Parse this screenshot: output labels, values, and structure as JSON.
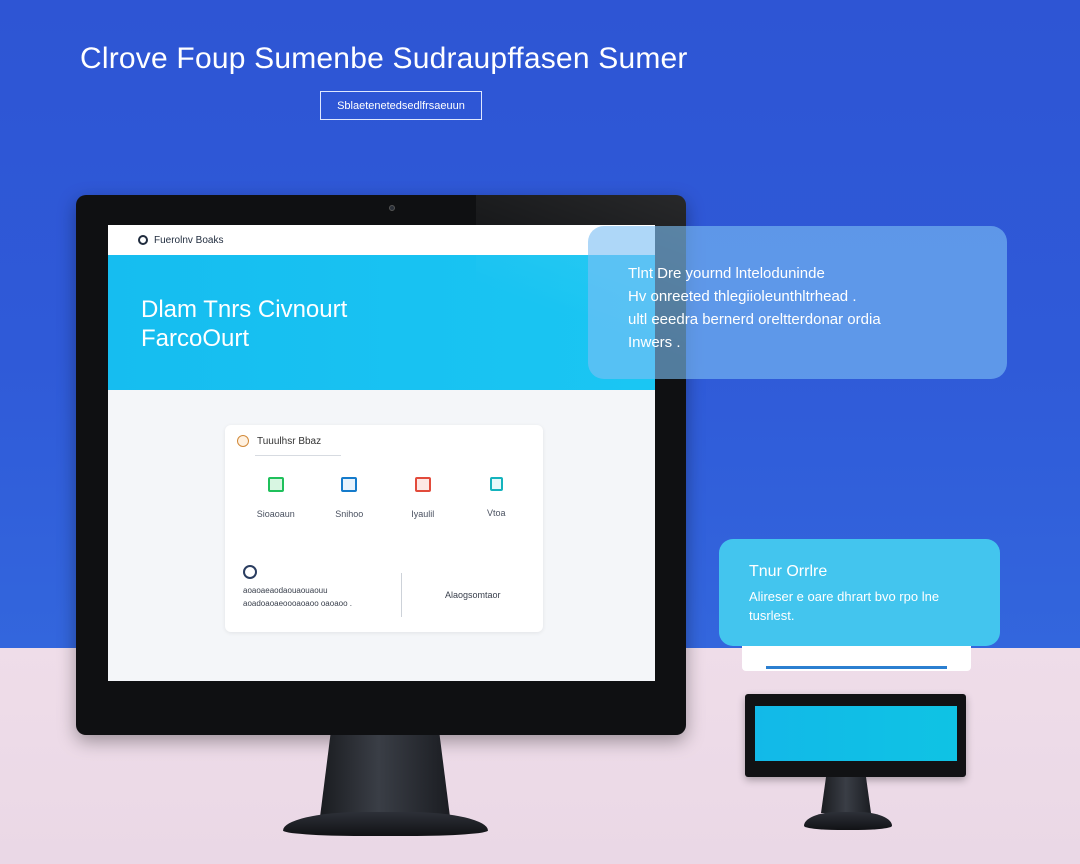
{
  "page": {
    "headline": "Clrove Foup Sumenbe Sudraupffasen Sumer",
    "subtag": "Sblaetenetedsedlfrsaeuun"
  },
  "monitor": {
    "app_name": "Fuerolnv Boaks",
    "hero_title_line1": "Dlam Tnrs Civnourt",
    "hero_title_line2": "FarcoOurt",
    "card": {
      "header_label": "Tuuulhsr Bbaz",
      "tiles": [
        {
          "label": "Sioaoaun",
          "icon": "chat-icon",
          "color": "#1fc05b"
        },
        {
          "label": "Snihoo",
          "icon": "folder-icon",
          "color": "#157bcb"
        },
        {
          "label": "Iyaulil",
          "icon": "calendar-icon",
          "color": "#e24b3b"
        },
        {
          "label": "Vtoa",
          "icon": "document-icon",
          "color": "#14b3bd"
        }
      ],
      "info_line1": "aoaoaeaodaouaouaouu",
      "info_line2": "aoadoaoaeoooaoaoo oaoaoo .",
      "info_action": "Alaogsomtaor"
    }
  },
  "callout_main": {
    "line1": "Tlnt  Dre  yournd lnteloduninde",
    "line2": "Hv onreeted thlegiioleunthltrhead .",
    "line3": "ultl eeedra bernerd oreltterdonar ordia",
    "line4": "Inwers ."
  },
  "callout_secondary": {
    "title": "Tnur Orrlre",
    "body_line1": "Alireser e oare dhrart bvo rpo lne",
    "body_line2": "tusrlest."
  },
  "colors": {
    "background_top": "#2e55d4",
    "background_bottom": "#ebd9e7",
    "hero": "#16bdf0",
    "callout_secondary": "#43c5ee"
  }
}
